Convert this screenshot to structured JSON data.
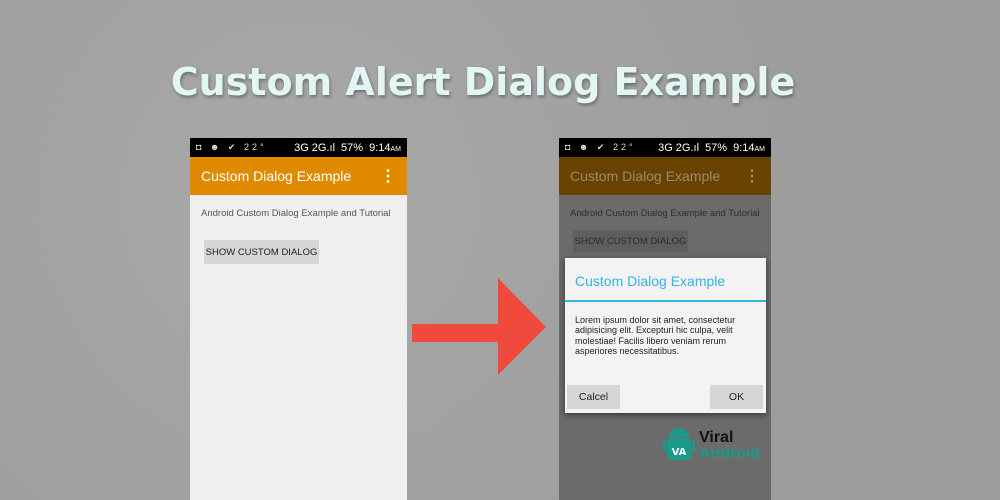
{
  "headline": "Custom Alert Dialog Example",
  "status": {
    "icons": "◘ ☻ ✔ 22°",
    "network": "3G  2G.ıl",
    "battery": "57%",
    "time": "9:14",
    "ampm": "AM"
  },
  "left": {
    "toolbar_title": "Custom Dialog Example",
    "description": "Android Custom Dialog Example and Tutorial",
    "button": "SHOW CUSTOM DIALOG"
  },
  "right": {
    "toolbar_title": "Custom Dialog Example",
    "description": "Android Custom Dialog Example and Tutorial",
    "button": "SHOW CUSTOM DIALOG",
    "dialog": {
      "title": "Custom Dialog Example",
      "message": "Lorem ipsum dolor sit amet, consectetur adipisicing elit. Excepturi hic culpa, velit molestiae! Facilis libero veniam rerum asperiores necessitatibus.",
      "cancel": "Calcel",
      "ok": "OK"
    }
  },
  "logo": {
    "line1": "Viral",
    "line2": "Android",
    "mark": "VA"
  },
  "colors": {
    "accent": "#e08a00",
    "dialog_title": "#33b5e5",
    "arrow": "#f04a3c",
    "logo": "#1a9a8a"
  }
}
